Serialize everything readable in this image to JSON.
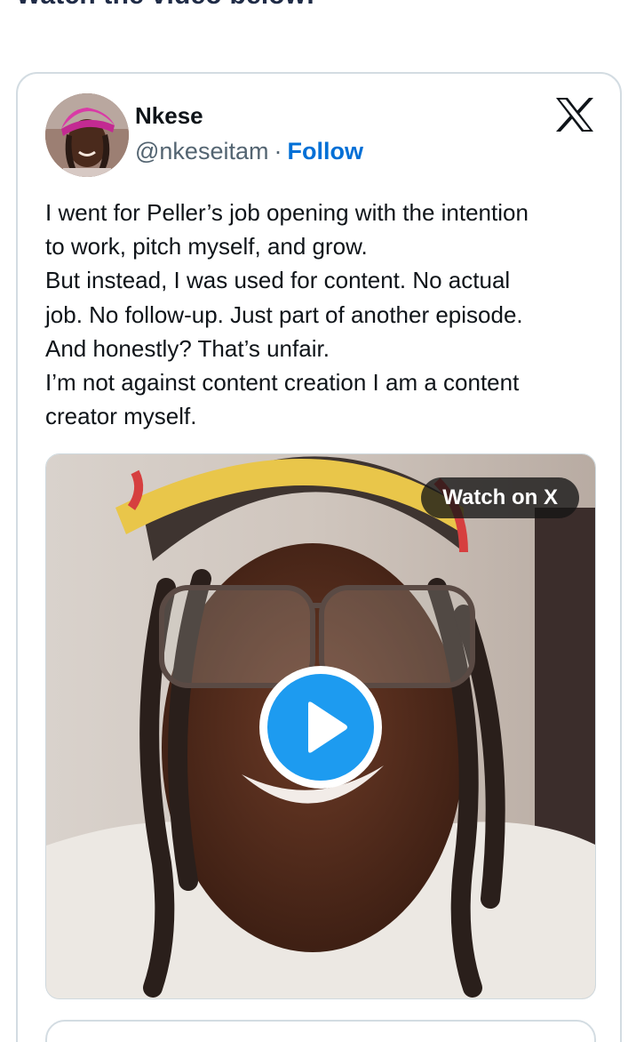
{
  "article": {
    "heading_cut": "Watch the video below:"
  },
  "tweet": {
    "author_name": "Nkese",
    "handle": "@nkeseitam",
    "separator": "·",
    "follow_label": "Follow",
    "text_lines": [
      "I went for Peller’s job opening with the intention",
      "to work, pitch myself, and grow.",
      "But instead, I was used for content. No actual",
      "job. No follow-up. Just part of another episode.",
      "And honestly? That’s unfair.",
      "I’m not against content creation I am a content",
      "creator myself."
    ],
    "video": {
      "watch_label": "Watch on X"
    }
  },
  "colors": {
    "follow_link": "#006fd6",
    "play_button": "#1d9bf0",
    "card_border": "#d3dce2",
    "text_primary": "#0f1419",
    "text_secondary": "#536471"
  },
  "icons": {
    "x_logo": "x-logo-icon",
    "play": "play-icon"
  }
}
